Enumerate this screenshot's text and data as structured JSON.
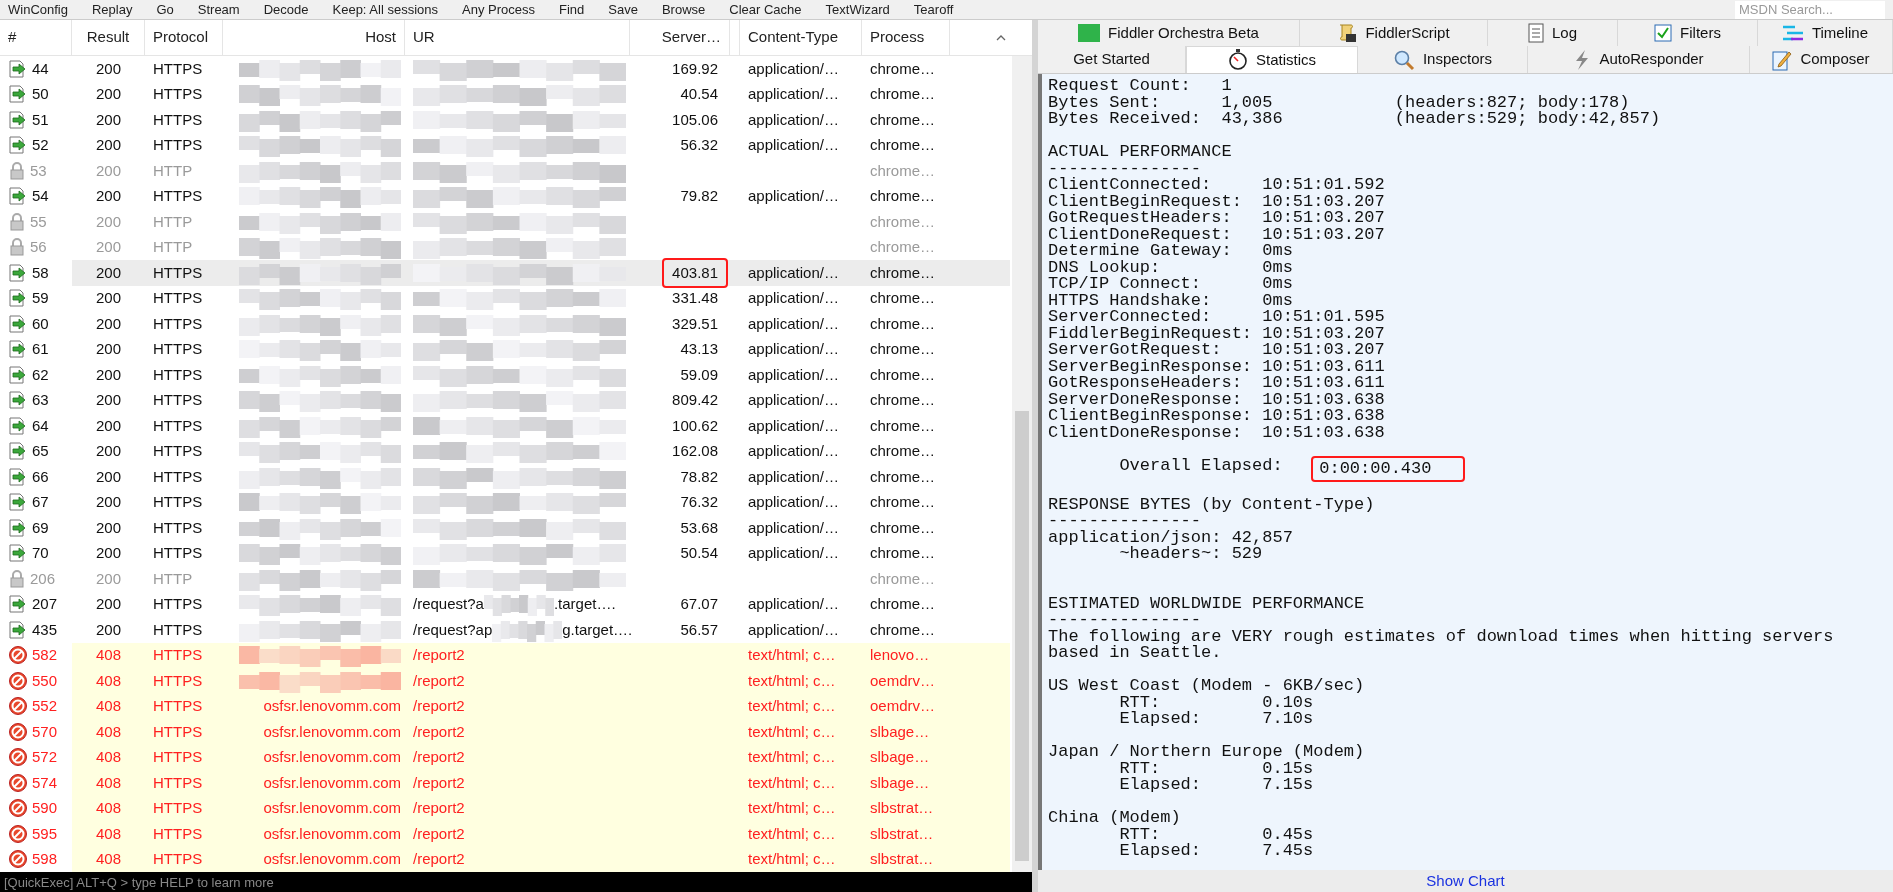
{
  "toolbar": [
    "WinConfig",
    "Replay",
    "Go",
    "Stream",
    "Decode",
    "Keep: All sessions",
    "Any Process",
    "Find",
    "Save",
    "Browse",
    "Clear Cache",
    "TextWizard",
    "Tearoff"
  ],
  "toolbar_search": {
    "placeholder": "MSDN Search..."
  },
  "sessions": {
    "columns": [
      "#",
      "Result",
      "Protocol",
      "Host",
      "UR",
      "Server…",
      "Content-Type",
      "Process"
    ],
    "rows": [
      {
        "kind": "ok",
        "id": "44",
        "result": "200",
        "protocol": "HTTPS",
        "server": "169.92",
        "content_type": "application/…",
        "process": "chrome…",
        "selected": false,
        "boxed": false
      },
      {
        "kind": "ok",
        "id": "50",
        "result": "200",
        "protocol": "HTTPS",
        "server": "40.54",
        "content_type": "application/…",
        "process": "chrome…",
        "selected": false,
        "boxed": false
      },
      {
        "kind": "ok",
        "id": "51",
        "result": "200",
        "protocol": "HTTPS",
        "server": "105.06",
        "content_type": "application/…",
        "process": "chrome…",
        "selected": false,
        "boxed": false
      },
      {
        "kind": "ok",
        "id": "52",
        "result": "200",
        "protocol": "HTTPS",
        "server": "56.32",
        "content_type": "application/…",
        "process": "chrome…",
        "selected": false,
        "boxed": false
      },
      {
        "kind": "tunnel",
        "id": "53",
        "result": "200",
        "protocol": "HTTP",
        "process": "chrome…",
        "selected": false,
        "boxed": false
      },
      {
        "kind": "ok",
        "id": "54",
        "result": "200",
        "protocol": "HTTPS",
        "server": "79.82",
        "content_type": "application/…",
        "process": "chrome…",
        "selected": false,
        "boxed": false
      },
      {
        "kind": "tunnel",
        "id": "55",
        "result": "200",
        "protocol": "HTTP",
        "process": "chrome…",
        "selected": false,
        "boxed": false
      },
      {
        "kind": "tunnel",
        "id": "56",
        "result": "200",
        "protocol": "HTTP",
        "process": "chrome…",
        "selected": false,
        "boxed": false
      },
      {
        "kind": "ok",
        "id": "58",
        "result": "200",
        "protocol": "HTTPS",
        "server": "403.81",
        "content_type": "application/…",
        "process": "chrome…",
        "selected": true,
        "boxed": true
      },
      {
        "kind": "ok",
        "id": "59",
        "result": "200",
        "protocol": "HTTPS",
        "server": "331.48",
        "content_type": "application/…",
        "process": "chrome…",
        "selected": false,
        "boxed": false
      },
      {
        "kind": "ok",
        "id": "60",
        "result": "200",
        "protocol": "HTTPS",
        "server": "329.51",
        "content_type": "application/…",
        "process": "chrome…",
        "selected": false,
        "boxed": false
      },
      {
        "kind": "ok",
        "id": "61",
        "result": "200",
        "protocol": "HTTPS",
        "server": "43.13",
        "content_type": "application/…",
        "process": "chrome…",
        "selected": false,
        "boxed": false
      },
      {
        "kind": "ok",
        "id": "62",
        "result": "200",
        "protocol": "HTTPS",
        "server": "59.09",
        "content_type": "application/…",
        "process": "chrome…",
        "selected": false,
        "boxed": false
      },
      {
        "kind": "ok",
        "id": "63",
        "result": "200",
        "protocol": "HTTPS",
        "server": "809.42",
        "content_type": "application/…",
        "process": "chrome…",
        "selected": false,
        "boxed": false
      },
      {
        "kind": "ok",
        "id": "64",
        "result": "200",
        "protocol": "HTTPS",
        "server": "100.62",
        "content_type": "application/…",
        "process": "chrome…",
        "selected": false,
        "boxed": false
      },
      {
        "kind": "ok",
        "id": "65",
        "result": "200",
        "protocol": "HTTPS",
        "server": "162.08",
        "content_type": "application/…",
        "process": "chrome…",
        "selected": false,
        "boxed": false
      },
      {
        "kind": "ok",
        "id": "66",
        "result": "200",
        "protocol": "HTTPS",
        "server": "78.82",
        "content_type": "application/…",
        "process": "chrome…",
        "selected": false,
        "boxed": false
      },
      {
        "kind": "ok",
        "id": "67",
        "result": "200",
        "protocol": "HTTPS",
        "server": "76.32",
        "content_type": "application/…",
        "process": "chrome…",
        "selected": false,
        "boxed": false
      },
      {
        "kind": "ok",
        "id": "69",
        "result": "200",
        "protocol": "HTTPS",
        "server": "53.68",
        "content_type": "application/…",
        "process": "chrome…",
        "selected": false,
        "boxed": false
      },
      {
        "kind": "ok",
        "id": "70",
        "result": "200",
        "protocol": "HTTPS",
        "server": "50.54",
        "content_type": "application/…",
        "process": "chrome…",
        "selected": false,
        "boxed": false
      },
      {
        "kind": "tunnel",
        "id": "206",
        "result": "200",
        "protocol": "HTTP",
        "process": "chrome…",
        "selected": false,
        "boxed": false
      },
      {
        "kind": "ok",
        "id": "207",
        "result": "200",
        "protocol": "HTTPS",
        "url": "/request?a",
        "url_tail": ".target….",
        "server": "67.07",
        "content_type": "application/…",
        "process": "chrome…",
        "selected": false,
        "boxed": false
      },
      {
        "kind": "ok",
        "id": "435",
        "result": "200",
        "protocol": "HTTPS",
        "url": "/request?ap",
        "url_tail": "g.target….",
        "server": "56.57",
        "content_type": "application/…",
        "process": "chrome…",
        "selected": false,
        "boxed": false
      },
      {
        "kind": "error",
        "id": "582",
        "result": "408",
        "protocol": "HTTPS",
        "url": "/report2",
        "content_type": "text/html; c…",
        "process": "lenovo…",
        "selected": false,
        "boxed": false
      },
      {
        "kind": "error",
        "id": "550",
        "result": "408",
        "protocol": "HTTPS",
        "url": "/report2",
        "content_type": "text/html; c…",
        "process": "oemdrv…",
        "selected": false,
        "boxed": false
      },
      {
        "kind": "error",
        "id": "552",
        "result": "408",
        "protocol": "HTTPS",
        "host": "osfsr.lenovomm.com",
        "url": "/report2",
        "content_type": "text/html; c…",
        "process": "oemdrv…",
        "selected": false,
        "boxed": false
      },
      {
        "kind": "error",
        "id": "570",
        "result": "408",
        "protocol": "HTTPS",
        "host": "osfsr.lenovomm.com",
        "url": "/report2",
        "content_type": "text/html; c…",
        "process": "slbage…",
        "selected": false,
        "boxed": false
      },
      {
        "kind": "error",
        "id": "572",
        "result": "408",
        "protocol": "HTTPS",
        "host": "osfsr.lenovomm.com",
        "url": "/report2",
        "content_type": "text/html; c…",
        "process": "slbage…",
        "selected": false,
        "boxed": false
      },
      {
        "kind": "error",
        "id": "574",
        "result": "408",
        "protocol": "HTTPS",
        "host": "osfsr.lenovomm.com",
        "url": "/report2",
        "content_type": "text/html; c…",
        "process": "slbage…",
        "selected": false,
        "boxed": false
      },
      {
        "kind": "error",
        "id": "590",
        "result": "408",
        "protocol": "HTTPS",
        "host": "osfsr.lenovomm.com",
        "url": "/report2",
        "content_type": "text/html; c…",
        "process": "slbstrat…",
        "selected": false,
        "boxed": false
      },
      {
        "kind": "error",
        "id": "595",
        "result": "408",
        "protocol": "HTTPS",
        "host": "osfsr.lenovomm.com",
        "url": "/report2",
        "content_type": "text/html; c…",
        "process": "slbstrat…",
        "selected": false,
        "boxed": false
      },
      {
        "kind": "error",
        "id": "598",
        "result": "408",
        "protocol": "HTTPS",
        "host": "osfsr.lenovomm.com",
        "url": "/report2",
        "content_type": "text/html; c…",
        "process": "slbstrat…",
        "selected": false,
        "boxed": false
      }
    ]
  },
  "quickexec": {
    "placeholder": "[QuickExec] ALT+Q > type HELP to learn more"
  },
  "tabs_top": [
    {
      "kind": "orchestra",
      "label": "Fiddler Orchestra Beta",
      "selected": false
    },
    {
      "kind": "script",
      "label": "FiddlerScript",
      "selected": false
    },
    {
      "kind": "log",
      "label": "Log",
      "selected": false
    },
    {
      "kind": "filters",
      "label": "Filters",
      "selected": false
    },
    {
      "kind": "timeline",
      "label": "Timeline",
      "selected": false
    }
  ],
  "tabs_bottom": [
    {
      "kind": "none",
      "label": "Get Started",
      "selected": false
    },
    {
      "kind": "stopwatch",
      "label": "Statistics",
      "selected": true
    },
    {
      "kind": "inspect",
      "label": "Inspectors",
      "selected": false
    },
    {
      "kind": "bolt",
      "label": "AutoResponder",
      "selected": false
    },
    {
      "kind": "compose",
      "label": "Composer",
      "selected": false
    }
  ],
  "statistics": [
    {
      "kind": "top",
      "lines": [
        {
          "text": "Request Count:   1"
        },
        {
          "text": "Bytes Sent:      1,005            (headers:827; body:178)"
        },
        {
          "text": "Bytes Received:  43,386           (headers:529; body:42,857)"
        }
      ]
    },
    {
      "kind": "block",
      "lines": [
        {
          "text": "ACTUAL PERFORMANCE"
        },
        {
          "text": "---------------"
        },
        {
          "text": "ClientConnected:     10:51:01.592"
        },
        {
          "text": "ClientBeginRequest:  10:51:03.207"
        },
        {
          "text": "GotRequestHeaders:   10:51:03.207"
        },
        {
          "text": "ClientDoneRequest:   10:51:03.207"
        },
        {
          "text": "Determine Gateway:   0ms"
        },
        {
          "text": "DNS Lookup:          0ms"
        },
        {
          "text": "TCP/IP Connect:      0ms"
        },
        {
          "text": "HTTPS Handshake:     0ms"
        },
        {
          "text": "ServerConnected:     10:51:01.595"
        },
        {
          "text": "FiddlerBeginRequest: 10:51:03.207"
        },
        {
          "text": "ServerGotRequest:    10:51:03.207"
        },
        {
          "text": "ServerBeginResponse: 10:51:03.611"
        },
        {
          "text": "GotResponseHeaders:  10:51:03.611"
        },
        {
          "text": "ServerDoneResponse:  10:51:03.638"
        },
        {
          "text": "ClientBeginResponse: 10:51:03.638"
        },
        {
          "text": "ClientDoneResponse:  10:51:03.638"
        }
      ]
    },
    {
      "kind": "block",
      "lines": [
        {
          "label": "       Overall Elapsed:   ",
          "value": "0:00:00.430",
          "boxed": true
        }
      ]
    },
    {
      "kind": "block",
      "lines": [
        {
          "text": "RESPONSE BYTES (by Content-Type)"
        },
        {
          "text": "---------------"
        },
        {
          "text": "application/json: 42,857"
        },
        {
          "text": "       ~headers~: 529"
        }
      ]
    },
    {
      "kind": "wide_block",
      "lines": [
        {
          "text": "ESTIMATED WORLDWIDE PERFORMANCE"
        },
        {
          "text": "---------------"
        },
        {
          "text": "The following are VERY rough estimates of download times when hitting servers"
        },
        {
          "text": "based in Seattle."
        }
      ]
    },
    {
      "kind": "block",
      "lines": [
        {
          "text": "US West Coast (Modem - 6KB/sec)"
        },
        {
          "text": "       RTT:          0.10s"
        },
        {
          "text": "       Elapsed:      7.10s"
        }
      ]
    },
    {
      "kind": "block",
      "lines": [
        {
          "text": "Japan / Northern Europe (Modem)"
        },
        {
          "text": "       RTT:          0.15s"
        },
        {
          "text": "       Elapsed:      7.15s"
        }
      ]
    },
    {
      "kind": "block",
      "lines": [
        {
          "text": "China (Modem)"
        },
        {
          "text": "       RTT:          0.45s"
        },
        {
          "text": "       Elapsed:      7.45s"
        }
      ]
    }
  ],
  "show_chart": "Show Chart"
}
